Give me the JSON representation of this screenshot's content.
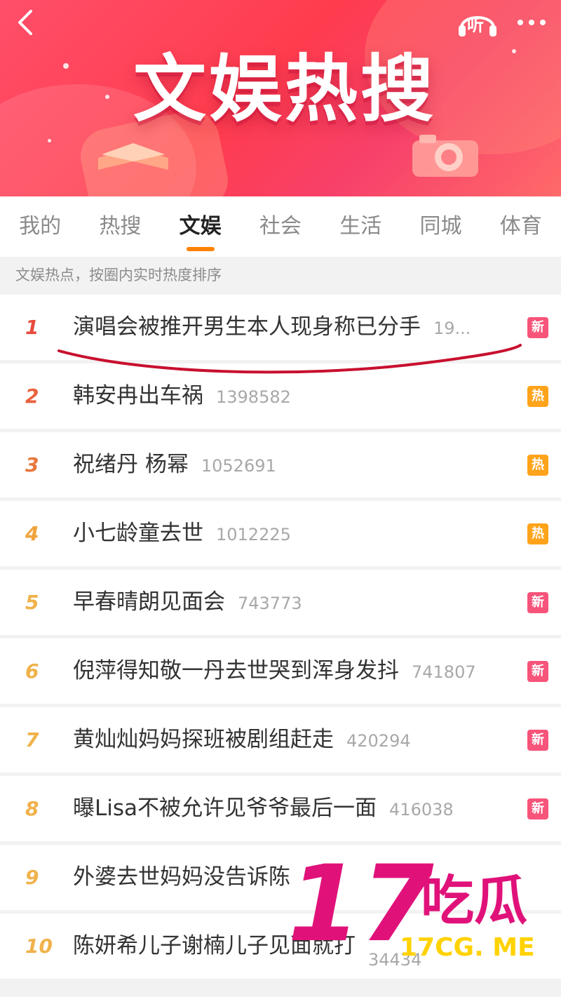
{
  "banner": {
    "title": "文娱热搜",
    "colors": {
      "primary": "#ff3c4e",
      "accent": "#ff8200"
    }
  },
  "nav": {
    "back_icon": "chevron-left-icon",
    "listen_label": "听",
    "more_icon": "ellipsis-icon"
  },
  "tabs": [
    {
      "label": "我的"
    },
    {
      "label": "热搜"
    },
    {
      "label": "文娱",
      "active": true
    },
    {
      "label": "社会"
    },
    {
      "label": "生活"
    },
    {
      "label": "同城"
    },
    {
      "label": "体育"
    }
  ],
  "subtitle": "文娱热点，按圈内实时热度排序",
  "list": [
    {
      "rank": "1",
      "title": "演唱会被推开男生本人现身称已分手",
      "count": "19...",
      "badge": "新",
      "badge_type": "new"
    },
    {
      "rank": "2",
      "title": "韩安冉出车祸",
      "count": "1398582",
      "badge": "热",
      "badge_type": "hot"
    },
    {
      "rank": "3",
      "title": "祝绪丹 杨幂",
      "count": "1052691",
      "badge": "热",
      "badge_type": "hot"
    },
    {
      "rank": "4",
      "title": "小七龄童去世",
      "count": "1012225",
      "badge": "热",
      "badge_type": "hot"
    },
    {
      "rank": "5",
      "title": "早春晴朗见面会",
      "count": "743773",
      "badge": "新",
      "badge_type": "new"
    },
    {
      "rank": "6",
      "title": "倪萍得知敬一丹去世哭到浑身发抖",
      "count": "741807",
      "badge": "新",
      "badge_type": "new"
    },
    {
      "rank": "7",
      "title": "黄灿灿妈妈探班被剧组赶走",
      "count": "420294",
      "badge": "新",
      "badge_type": "new"
    },
    {
      "rank": "8",
      "title": "曝Lisa不被允许见爷爷最后一面",
      "count": "416038",
      "badge": "新",
      "badge_type": "new"
    },
    {
      "rank": "9",
      "title": "外婆去世妈妈没告诉陈",
      "count": "",
      "badge": "",
      "badge_type": ""
    },
    {
      "rank": "10",
      "title": "陈妍希儿子谢楠儿子见面就打",
      "count": "34434",
      "badge": "",
      "badge_type": ""
    }
  ],
  "rank_colors": [
    "#e84a3e",
    "#e8623e",
    "#e8773e",
    "#f0a33c",
    "#f0b24a",
    "#f0b24a",
    "#f0b24a",
    "#f0b24a",
    "#f0b24a",
    "#f0b24a"
  ],
  "badge_colors": {
    "new": "#f7547a",
    "hot": "#ffa31a"
  },
  "watermark": {
    "number": "17",
    "name": "吃瓜",
    "site": "17CG. ME"
  }
}
